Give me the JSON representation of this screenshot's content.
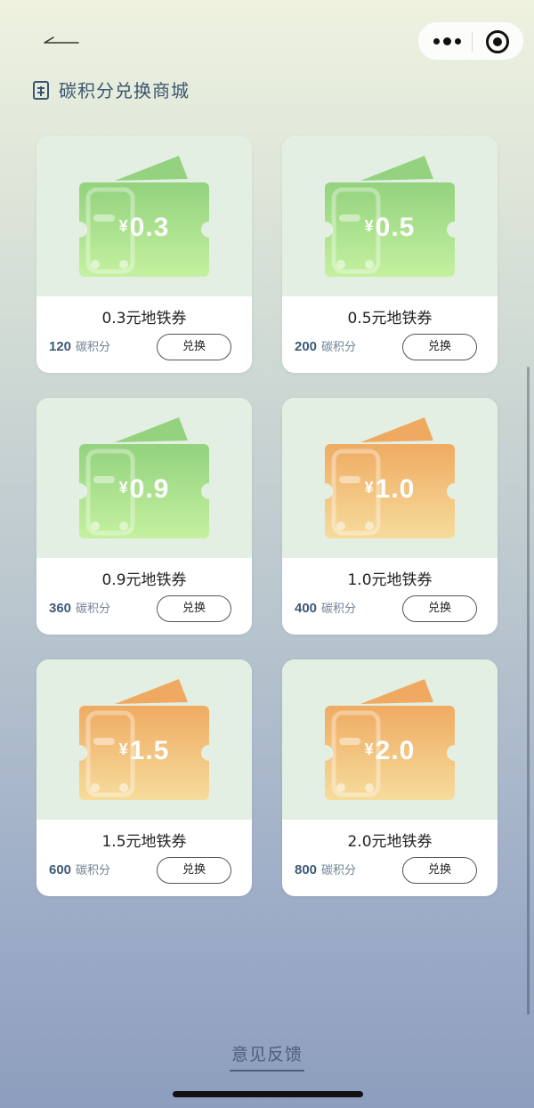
{
  "header": {
    "title": "碳积分兑换商城",
    "back_icon": "back-arrow-icon",
    "more_icon": "more-dots-icon",
    "close_icon": "target-close-icon"
  },
  "colors": {
    "green_ticket": "#9bd98a",
    "orange_ticket": "#f1b36a",
    "card_art_bg": "#e4efe3",
    "points_text": "#3d5a78"
  },
  "products": [
    {
      "amount": "0.3",
      "currency": "¥",
      "name": "0.3元地铁券",
      "points": "120",
      "points_unit": "碳积分",
      "button": "兑换",
      "theme": "green"
    },
    {
      "amount": "0.5",
      "currency": "¥",
      "name": "0.5元地铁券",
      "points": "200",
      "points_unit": "碳积分",
      "button": "兑换",
      "theme": "green"
    },
    {
      "amount": "0.9",
      "currency": "¥",
      "name": "0.9元地铁券",
      "points": "360",
      "points_unit": "碳积分",
      "button": "兑换",
      "theme": "green"
    },
    {
      "amount": "1.0",
      "currency": "¥",
      "name": "1.0元地铁券",
      "points": "400",
      "points_unit": "碳积分",
      "button": "兑换",
      "theme": "orange"
    },
    {
      "amount": "1.5",
      "currency": "¥",
      "name": "1.5元地铁券",
      "points": "600",
      "points_unit": "碳积分",
      "button": "兑换",
      "theme": "orange"
    },
    {
      "amount": "2.0",
      "currency": "¥",
      "name": "2.0元地铁券",
      "points": "800",
      "points_unit": "碳积分",
      "button": "兑换",
      "theme": "orange"
    }
  ],
  "footer": {
    "feedback_label": "意见反馈"
  }
}
